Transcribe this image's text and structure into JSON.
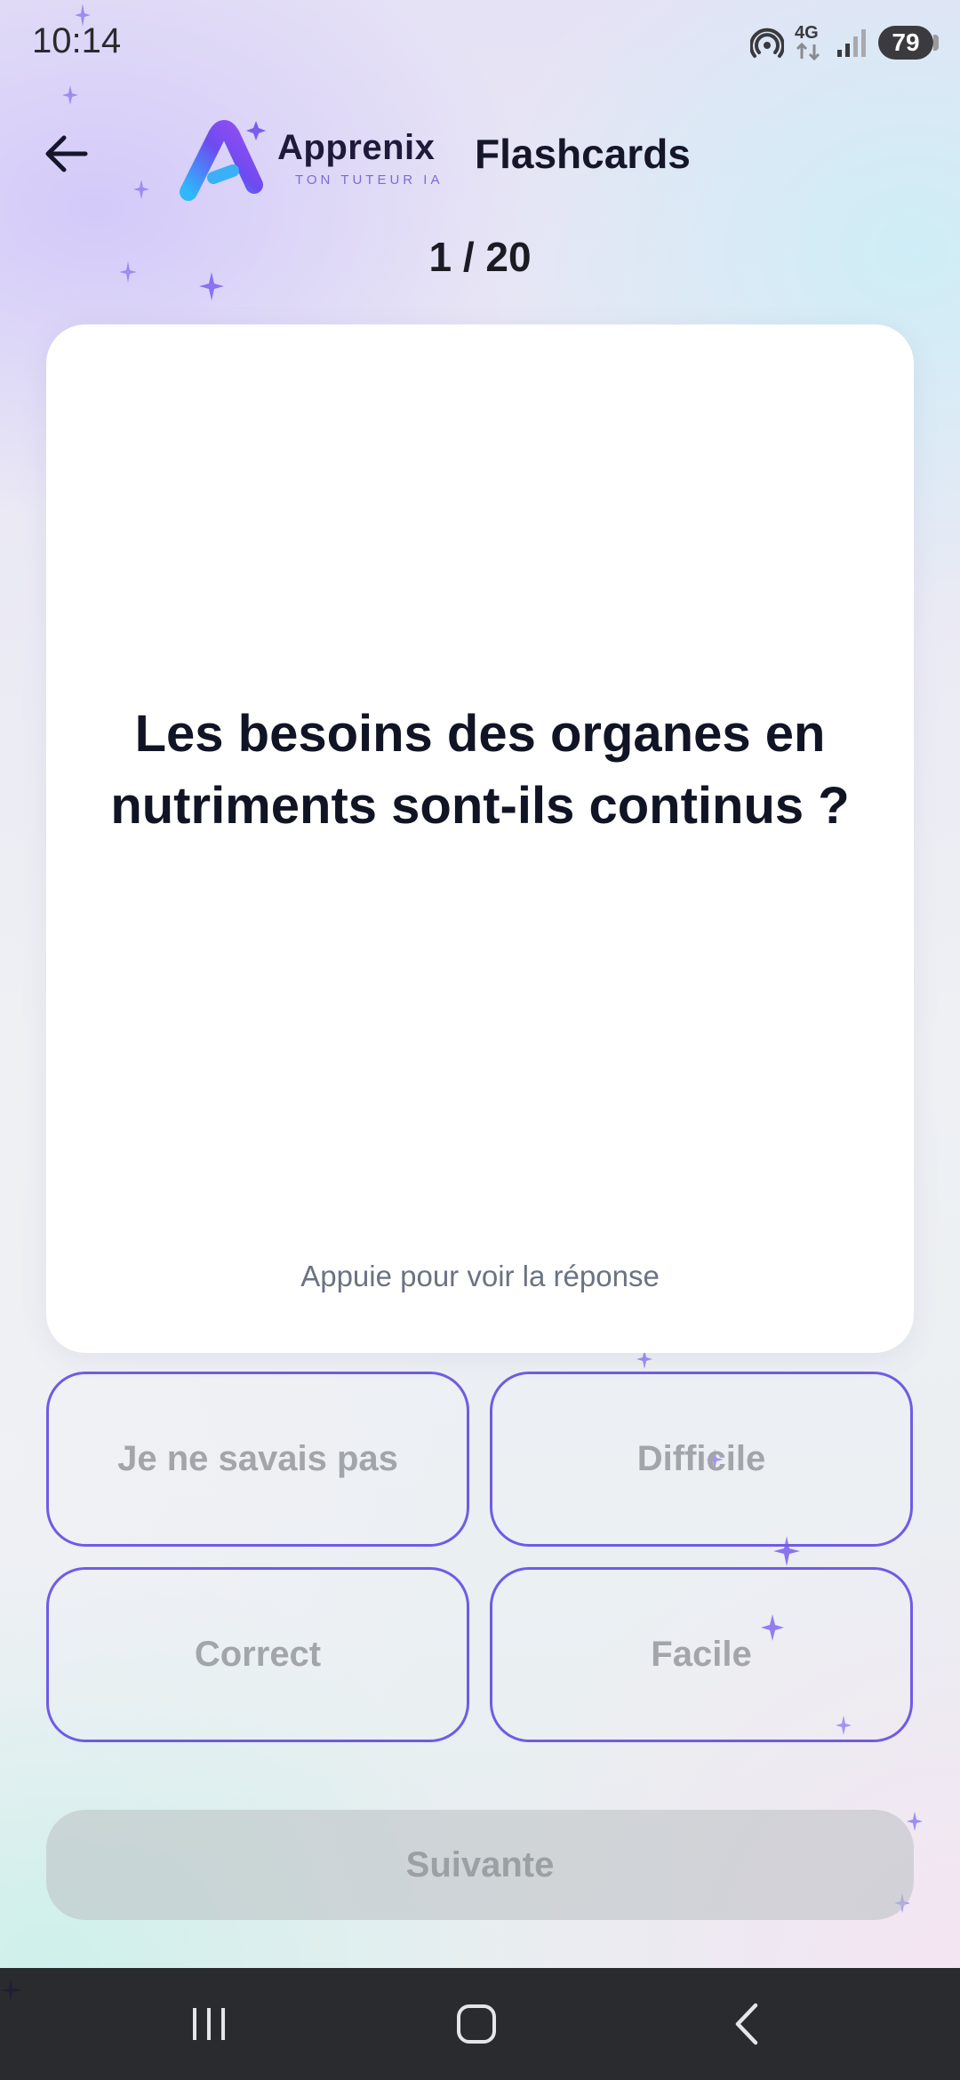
{
  "status_bar": {
    "time": "10:14",
    "network": "4G",
    "battery": "79",
    "icons": [
      "hotspot-icon",
      "mobile-data-icon",
      "signal-icon",
      "battery-icon"
    ]
  },
  "header": {
    "back_icon": "arrow-left-icon",
    "logo_name": "Apprenix",
    "logo_tagline": "TON TUTEUR IA",
    "title": "Flashcards"
  },
  "progress": {
    "current": 1,
    "total": 20,
    "label": "1 / 20"
  },
  "card": {
    "question": "Les besoins des organes en nutriments sont-ils continus ?",
    "hint": "Appuie pour voir la réponse"
  },
  "rating_buttons": {
    "unknown": "Je ne savais pas",
    "difficult": "Difficile",
    "correct": "Correct",
    "easy": "Facile"
  },
  "next_button": "Suivante",
  "colors": {
    "accent": "#6f5be6",
    "text_dark": "#111424",
    "muted": "#6b7383",
    "disabled_text": "#a2a6ab",
    "nav_bar": "#2a2b2e"
  },
  "nav_bar": {
    "icons": [
      "recents-icon",
      "home-icon",
      "back-icon"
    ]
  }
}
